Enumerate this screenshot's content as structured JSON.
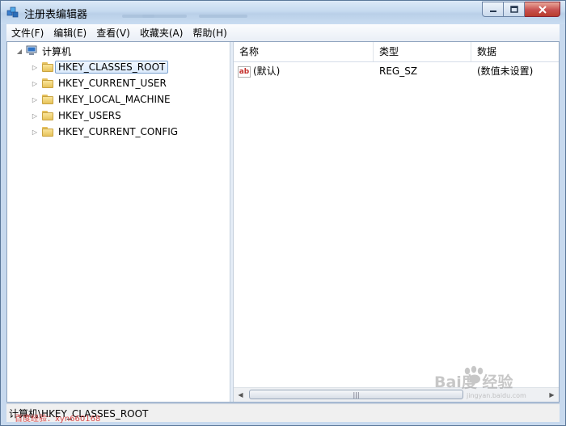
{
  "window": {
    "title": "注册表编辑器"
  },
  "menubar": {
    "items": [
      "文件(F)",
      "编辑(E)",
      "查看(V)",
      "收藏夹(A)",
      "帮助(H)"
    ]
  },
  "tree": {
    "root": "计算机",
    "hives": [
      "HKEY_CLASSES_ROOT",
      "HKEY_CURRENT_USER",
      "HKEY_LOCAL_MACHINE",
      "HKEY_USERS",
      "HKEY_CURRENT_CONFIG"
    ],
    "selected": "HKEY_CLASSES_ROOT"
  },
  "list": {
    "columns": [
      "名称",
      "类型",
      "数据"
    ],
    "rows": [
      {
        "icon": "string-value-icon",
        "icon_text": "ab",
        "name": "(默认)",
        "type": "REG_SZ",
        "data": "(数值未设置)"
      }
    ]
  },
  "statusbar": {
    "path": "计算机\\HKEY_CLASSES_ROOT"
  },
  "watermark": {
    "small": "百度经验：xyn660168",
    "logo": "Bai度 经验",
    "url": "jingyan.baidu.com"
  },
  "colors": {
    "title_bar": "#c5d9ef",
    "close_button": "#c75050",
    "selection_border": "#7da2ce",
    "folder": "#e7c35a"
  }
}
